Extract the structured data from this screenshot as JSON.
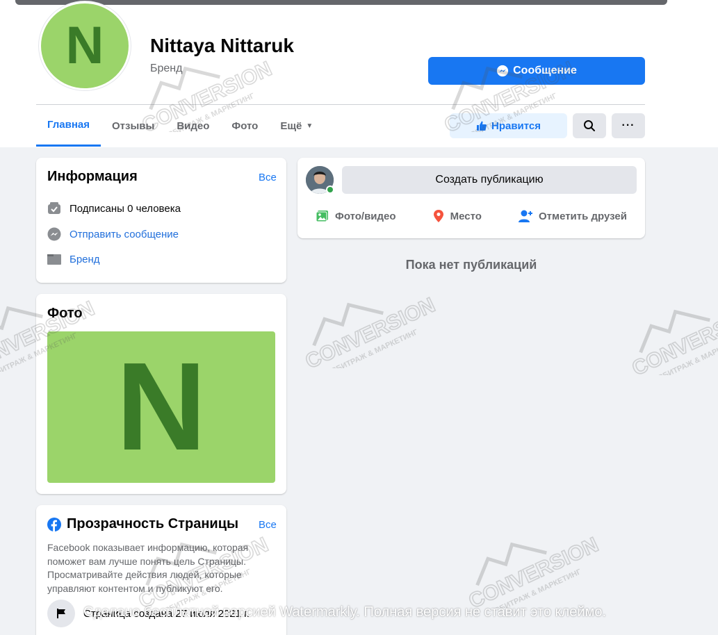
{
  "profile": {
    "avatar_letter": "N",
    "name": "Nittaya Nittaruk",
    "category": "Бренд",
    "message_button": "Сообщение"
  },
  "tabs": [
    {
      "label": "Главная"
    },
    {
      "label": "Отзывы"
    },
    {
      "label": "Видео"
    },
    {
      "label": "Фото"
    },
    {
      "label": "Ещё"
    }
  ],
  "actions": {
    "like_button": "Нравится",
    "more_button": "···"
  },
  "info": {
    "title": "Информация",
    "see_all": "Все",
    "followers": "Подписаны 0 человека",
    "send_message": "Отправить сообщение",
    "category": "Бренд"
  },
  "photos": {
    "title": "Фото",
    "photo_letter": "N"
  },
  "transparency": {
    "title": "Прозрачность Страницы",
    "see_all": "Все",
    "description": "Facebook показывает информацию, которая поможет вам лучше понять цель Страницы. Просматривайте действия людей, которые управляют контентом и публикуют его.",
    "created": "Страница создана 27 июля 2021 г."
  },
  "composer": {
    "create_post": "Создать публикацию",
    "photo_video": "Фото/видео",
    "location": "Место",
    "tag_friends": "Отметить друзей"
  },
  "feed": {
    "empty_text": "Пока нет публикаций"
  },
  "overlay": {
    "watermark_notice": "Сделано бесплатной версией Watermarkly. Полная версия не ставит это клеймо.",
    "logo_main": "CONVERSION",
    "logo_sub": "АРБИТРАЖ & МАРКЕТИНГ"
  },
  "colors": {
    "brand_blue": "#1877f2",
    "avatar_green": "#9bd46a",
    "letter_green": "#3a7b28",
    "online_green": "#31a24c"
  }
}
